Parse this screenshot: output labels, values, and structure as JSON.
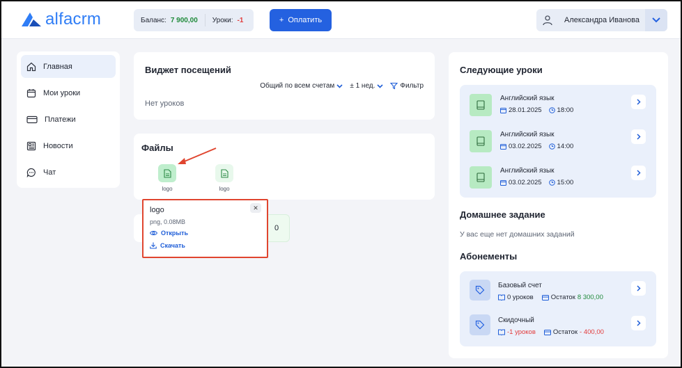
{
  "brand": {
    "name": "alfacrm"
  },
  "header": {
    "balance_label": "Баланс:",
    "balance_value": "7 900,00",
    "lessons_label": "Уроки:",
    "lessons_value": "-1",
    "pay_label": "Оплатить",
    "user_name": "Александра Иванова"
  },
  "sidebar": {
    "items": [
      {
        "label": "Главная",
        "icon": "home-icon"
      },
      {
        "label": "Мои уроки",
        "icon": "calendar-icon"
      },
      {
        "label": "Платежи",
        "icon": "card-icon"
      },
      {
        "label": "Новости",
        "icon": "news-icon"
      },
      {
        "label": "Чат",
        "icon": "chat-icon"
      }
    ]
  },
  "visits": {
    "title": "Виджет посещений",
    "account_filter": "Общий по всем счетам",
    "period_filter": "± 1 нед.",
    "filter_label": "Фильтр",
    "empty": "Нет уроков"
  },
  "files": {
    "title": "Файлы",
    "items": [
      {
        "label": "logo"
      },
      {
        "label": "logo"
      }
    ]
  },
  "lower_card": {
    "value": "0"
  },
  "popover": {
    "title": "logo",
    "meta": "png, 0.08MB",
    "open_label": "Открыть",
    "download_label": "Скачать"
  },
  "next_lessons": {
    "title": "Следующие уроки",
    "items": [
      {
        "subject": "Английский язык",
        "date": "28.01.2025",
        "time": "18:00"
      },
      {
        "subject": "Английский язык",
        "date": "03.02.2025",
        "time": "14:00"
      },
      {
        "subject": "Английский язык",
        "date": "03.02.2025",
        "time": "15:00"
      }
    ]
  },
  "homework": {
    "title": "Домашнее задание",
    "empty": "У вас еще нет домашних заданий"
  },
  "subscriptions": {
    "title": "Абонементы",
    "items": [
      {
        "name": "Базовый счет",
        "lessons": "0 уроков",
        "rest_label": "Остаток",
        "rest_value": "8 300,00",
        "lessons_color": "#1f2430",
        "rest_color": "#1f8a3a"
      },
      {
        "name": "Скидочный",
        "lessons": "-1 уроков",
        "rest_label": "Остаток",
        "rest_value": "- 400,00",
        "lessons_color": "#e23b3b",
        "rest_color": "#e23b3b"
      }
    ]
  },
  "colors": {
    "accent": "#2461e0",
    "highlight_border": "#e0452f",
    "positive": "#1f8a3a",
    "negative": "#e23b3b"
  }
}
